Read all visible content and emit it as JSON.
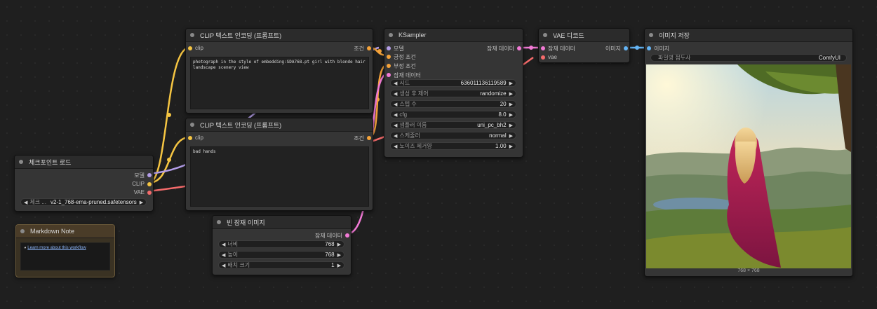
{
  "colors": {
    "clip": "#f5c542",
    "model": "#b49ee8",
    "vae": "#f56b6b",
    "latent": "#f27ad6",
    "image": "#64b5f6",
    "conditioning": "#f5a33a"
  },
  "checkpoint_loader": {
    "title": "체크포인트 로드",
    "outputs": [
      "모델",
      "CLIP",
      "VAE"
    ],
    "ckpt_label": "체크 ...",
    "ckpt_value": "v2-1_768-ema-pruned.safetensors"
  },
  "clip_encode_positive": {
    "title": "CLIP 텍스트 인코딩 (프롬프트)",
    "input": "clip",
    "output": "조건",
    "text": "photograph in the style of embedding:SDA768.pt girl with blonde hair landscape scenery view"
  },
  "clip_encode_negative": {
    "title": "CLIP 텍스트 인코딩 (프롬프트)",
    "input": "clip",
    "output": "조건",
    "text": "bad hands"
  },
  "ksampler": {
    "title": "KSampler",
    "inputs": [
      "모델",
      "긍정 조건",
      "부정 조건",
      "잠재 데이터"
    ],
    "output": "잠재 데이터",
    "widgets": [
      {
        "label": "시드",
        "value": "636011136119589"
      },
      {
        "label": "생성 후 제어",
        "value": "randomize"
      },
      {
        "label": "스텝 수",
        "value": "20"
      },
      {
        "label": "cfg",
        "value": "8.0"
      },
      {
        "label": "샘플러 이름",
        "value": "uni_pc_bh2"
      },
      {
        "label": "스케줄러",
        "value": "normal"
      },
      {
        "label": "노이즈 제거양",
        "value": "1.00"
      }
    ]
  },
  "vae_decode": {
    "title": "VAE 디코드",
    "inputs": [
      "잠재 데이터",
      "vae"
    ],
    "output": "이미지"
  },
  "save_image": {
    "title": "이미지 저장",
    "input": "이미지",
    "prefix_label": "파일명 접두사",
    "prefix_value": "ComfyUI",
    "caption": "768 × 768"
  },
  "empty_latent": {
    "title": "빈 잠재 이미지",
    "output": "잠재 데이터",
    "widgets": [
      {
        "label": "너비",
        "value": "768"
      },
      {
        "label": "높이",
        "value": "768"
      },
      {
        "label": "배치 크기",
        "value": "1"
      }
    ]
  },
  "markdown_note": {
    "title": "Markdown Note",
    "link_text": "Learn more about this workflow"
  }
}
